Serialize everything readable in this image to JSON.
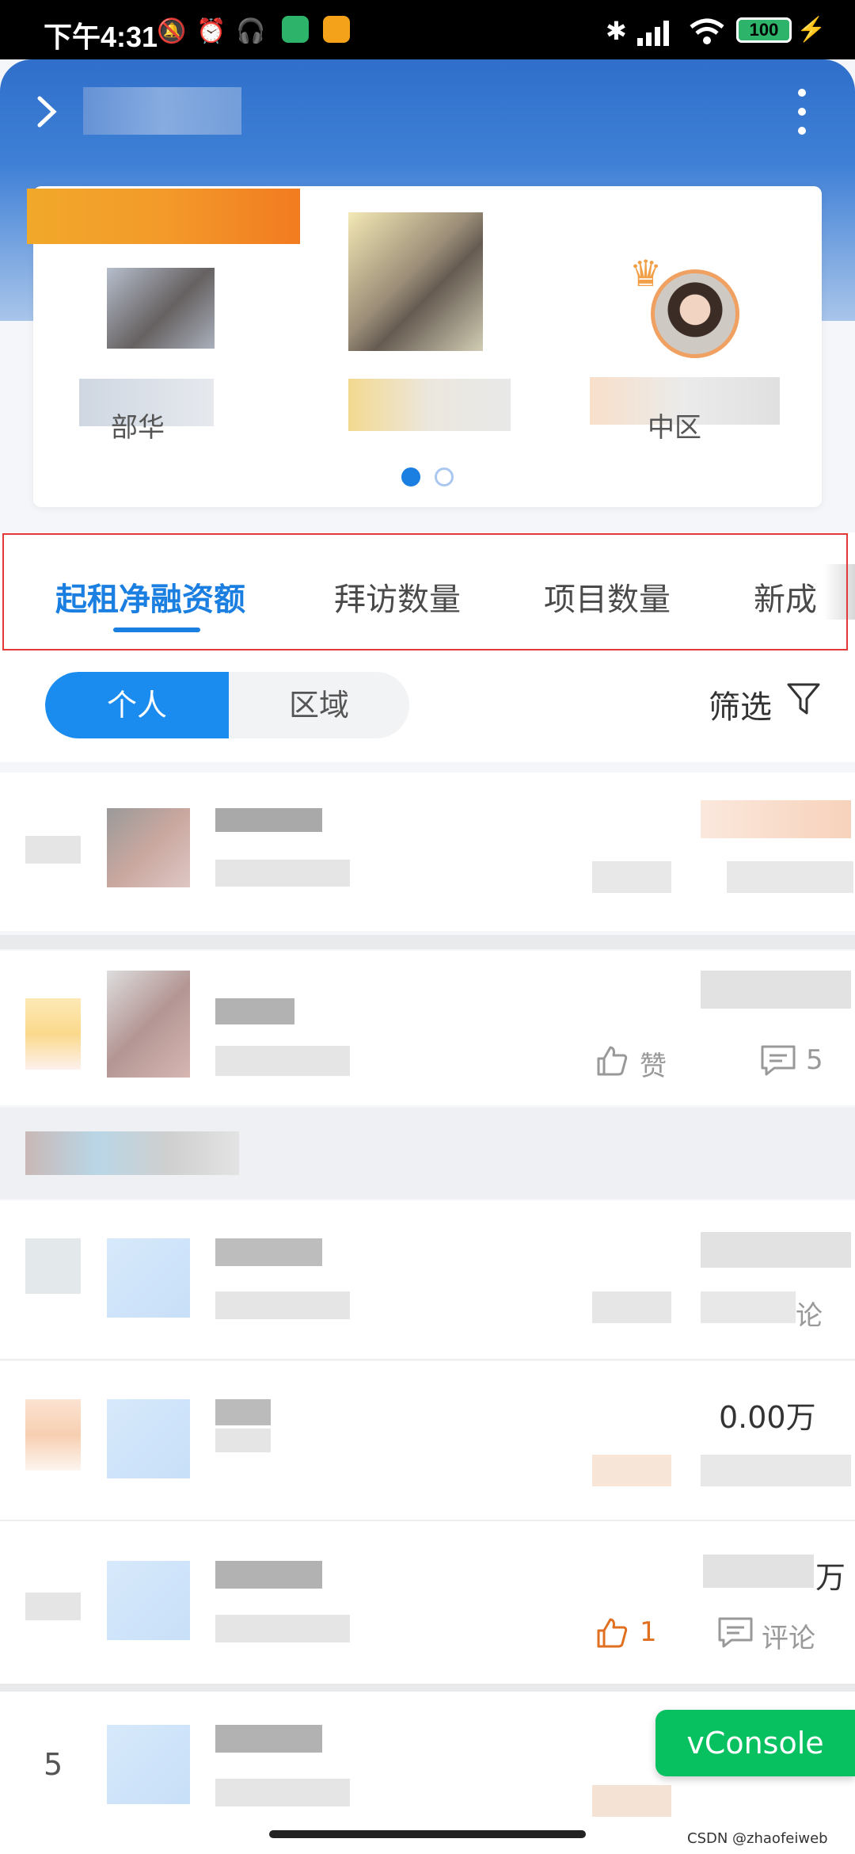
{
  "status_bar": {
    "time": "下午4:31",
    "battery": "100"
  },
  "header": {
    "back_icon": "chevron-right-icon",
    "more_icon": "more-vertical-icon"
  },
  "carousel": {
    "card_labels": [
      "部华",
      "中区"
    ],
    "page_dots": 2,
    "active_dot": 0
  },
  "tabs": [
    {
      "label": "起租净融资额",
      "active": true
    },
    {
      "label": "拜访数量",
      "active": false
    },
    {
      "label": "项目数量",
      "active": false
    },
    {
      "label": "新成",
      "active": false
    }
  ],
  "segment": {
    "personal": "个人",
    "region": "区域"
  },
  "filter": {
    "label": "筛选",
    "icon": "funnel-icon"
  },
  "list_texts": {
    "like_label": "赞",
    "comment_count": "5",
    "like_count": "1",
    "comment_label": "评论",
    "row_index": "5",
    "amount_1": "0.00万",
    "unit_wan": "万",
    "partial_comment": "论"
  },
  "vconsole": "vConsole",
  "watermark": "CSDN @zhaofeiweb",
  "colors": {
    "primary": "#1a8cf0",
    "header_blue": "#3a7bd5",
    "highlight_red": "#e23a3a",
    "like_orange": "#e07020",
    "vconsole_green": "#07c160"
  }
}
